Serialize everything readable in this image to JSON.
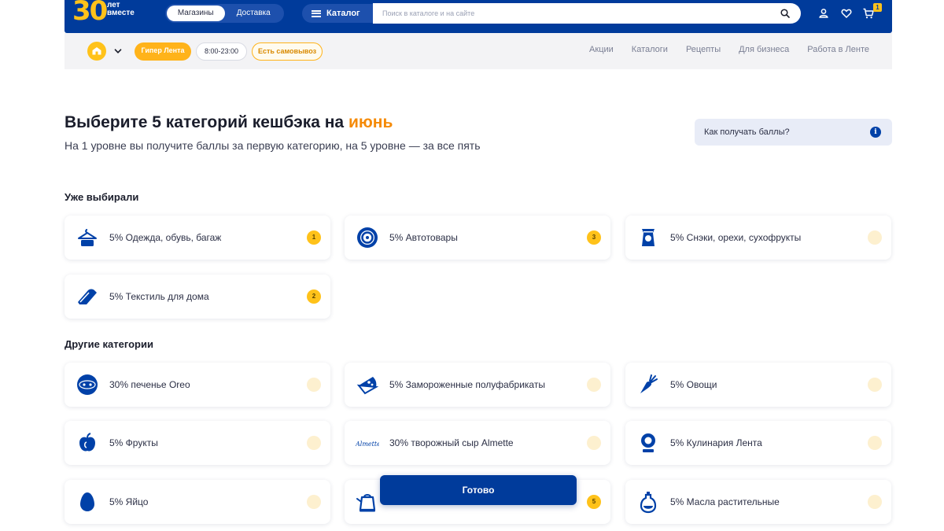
{
  "header": {
    "logo_number": "30",
    "logo_text": "лет вместе",
    "segments": [
      "Магазины",
      "Доставка"
    ],
    "catalog_label": "Каталог",
    "search_placeholder": "Поиск в каталоге и на сайте",
    "cart_count": "1",
    "icons": [
      "search-icon",
      "user-icon",
      "heart-icon",
      "cart-icon"
    ]
  },
  "subbar": {
    "store": "Гипер Лента",
    "hours": "8:00-23:00",
    "pickup": "Есть самовывоз",
    "nav": [
      "Акции",
      "Каталоги",
      "Рецепты",
      "Для бизнеса",
      "Работа в Ленте"
    ]
  },
  "main": {
    "title_prefix": "Выберите 5 категорий кешбэка на ",
    "title_accent": "июнь",
    "subtitle": "На 1 уровне вы получите баллы за первую категорию, на 5 уровне — за все пять",
    "howto_label": "Как получать баллы?",
    "info_symbol": "i",
    "chosen_title": "Уже выбирали",
    "other_title": "Другие категории",
    "done_label": "Готово"
  },
  "chosen": [
    {
      "label": "5% Одежда, обувь, багаж",
      "icon": "hanger-icon",
      "rank": "1"
    },
    {
      "label": "5% Автотовары",
      "icon": "tire-icon",
      "rank": "3"
    },
    {
      "label": "5% Снэки, орехи, сухофрукты",
      "icon": "snack-bag-icon",
      "rank": ""
    },
    {
      "label": "5% Текстиль для дома",
      "icon": "towel-icon",
      "rank": "2"
    }
  ],
  "other": [
    {
      "label": "30% печенье Oreo",
      "icon": "oreo-logo-icon",
      "rank": ""
    },
    {
      "label": "5% Замороженные полуфабрикаты",
      "icon": "pizza-icon",
      "rank": ""
    },
    {
      "label": "5% Овощи",
      "icon": "carrot-icon",
      "rank": ""
    },
    {
      "label": "5% Фрукты",
      "icon": "apple-icon",
      "rank": ""
    },
    {
      "label": "30% творожный сыр Almette",
      "icon": "almette-logo-icon",
      "rank": "",
      "logo_text": "Almette"
    },
    {
      "label": "5% Кулинария Лента",
      "icon": "lenta-chef-icon",
      "rank": ""
    },
    {
      "label": "5% Яйцо",
      "icon": "egg-icon",
      "rank": ""
    },
    {
      "label": "",
      "icon": "kettle-icon",
      "rank": "5"
    },
    {
      "label": "5% Масла растительные",
      "icon": "oil-bottle-icon",
      "rank": ""
    }
  ],
  "colors": {
    "brand_blue": "#003b9b",
    "accent_orange": "#f58a07",
    "badge_yellow": "#ffc21a"
  }
}
